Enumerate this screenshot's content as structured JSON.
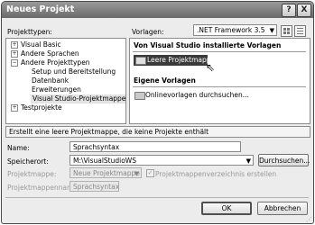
{
  "window": {
    "title": "Neues Projekt",
    "help_button": "?",
    "close_button": "X"
  },
  "top": {
    "project_types_label": "Projekttypen:",
    "templates_label": "Vorlagen:",
    "framework_value": ".NET Framework 3.5"
  },
  "tree": {
    "items": [
      {
        "label": "Visual Basic",
        "expander": "+"
      },
      {
        "label": "Andere Sprachen",
        "expander": "+"
      },
      {
        "label": "Andere Projekttypen",
        "expander": "−"
      },
      {
        "label": "Setup und Bereitstellung"
      },
      {
        "label": "Datenbank"
      },
      {
        "label": "Erweiterungen"
      },
      {
        "label": "Visual Studio-Projektmappen"
      },
      {
        "label": "Testprojekte",
        "expander": "+"
      }
    ]
  },
  "templates": {
    "installed_header": "Von Visual Studio installierte Vorlagen",
    "blank_solution": "Leere Projektmappe",
    "my_header": "Eigene Vorlagen",
    "online_search": "Onlinevorlagen durchsuchen..."
  },
  "description": "Erstellt eine leere Projektmappe, die keine Projekte enthält",
  "form": {
    "name_label": "Name:",
    "name_value": "Sprachsyntax",
    "location_label": "Speicherort:",
    "location_value": "M:\\VisualStudioWS",
    "browse_label": "Durchsuchen...",
    "solution_label": "Projektmappe:",
    "solution_value": "Neue Projektmappe",
    "create_dir_label": "Projektmappenverzeichnis erstellen",
    "solution_name_label": "Projektmappenname:",
    "solution_name_value": "Sprachsyntax"
  },
  "buttons": {
    "ok": "OK",
    "cancel": "Abbrechen"
  }
}
